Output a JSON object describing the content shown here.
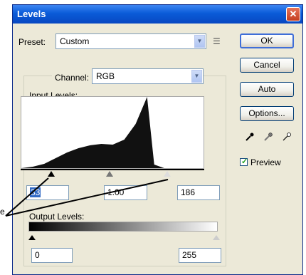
{
  "window": {
    "title": "Levels"
  },
  "preset": {
    "label": "Preset:",
    "value": "Custom"
  },
  "buttons": {
    "ok": "OK",
    "cancel": "Cancel",
    "auto": "Auto",
    "options": "Options..."
  },
  "channel": {
    "label": "Channel:",
    "value": "RGB"
  },
  "input_levels": {
    "label": "Input Levels:",
    "black": "33",
    "gamma": "1.00",
    "white": "186"
  },
  "output_levels": {
    "label": "Output Levels:",
    "black": "0",
    "white": "255"
  },
  "preview": {
    "label": "Preview",
    "checked": true
  },
  "callout": {
    "text": "e"
  },
  "colors": {
    "titlebar": "#0a5bd8",
    "dialog_bg": "#ece9d8",
    "accent": "#3f6ed8"
  },
  "chart_data": {
    "type": "area",
    "x": [
      0,
      16,
      32,
      48,
      64,
      80,
      96,
      112,
      128,
      144,
      160,
      176,
      186,
      200,
      255
    ],
    "y": [
      0,
      0.02,
      0.06,
      0.14,
      0.22,
      0.28,
      0.32,
      0.34,
      0.33,
      0.4,
      0.62,
      1.0,
      0.05,
      0,
      0
    ],
    "xlim": [
      0,
      255
    ]
  }
}
